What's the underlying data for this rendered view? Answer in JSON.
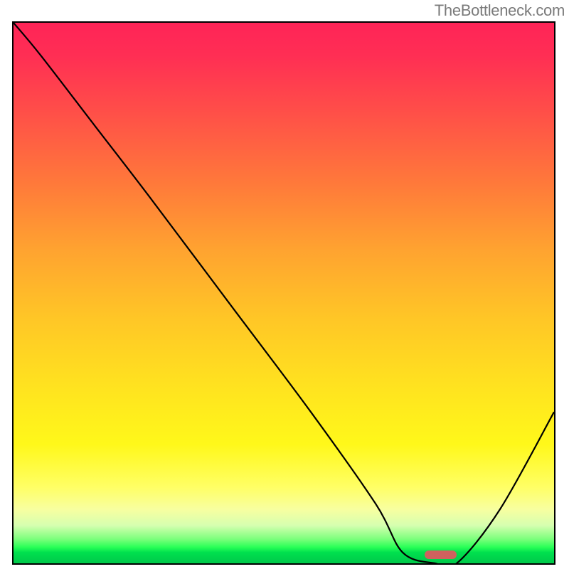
{
  "watermark": "TheBottleneck.com",
  "chart_data": {
    "type": "line",
    "title": "",
    "xlabel": "",
    "ylabel": "",
    "xlim": [
      0,
      100
    ],
    "ylim": [
      0,
      100
    ],
    "x": [
      0,
      5,
      15,
      25,
      40,
      55,
      67,
      72,
      78,
      82,
      90,
      100
    ],
    "values": [
      100,
      94,
      81,
      68,
      48,
      28,
      11,
      2,
      0,
      0,
      10,
      28
    ],
    "minimum_marker": {
      "x_start": 76,
      "x_end": 82,
      "y": 0
    },
    "gradient_scale": {
      "top": "#ff2457",
      "mid": "#ffe41f",
      "bottom": "#00c94a"
    }
  }
}
